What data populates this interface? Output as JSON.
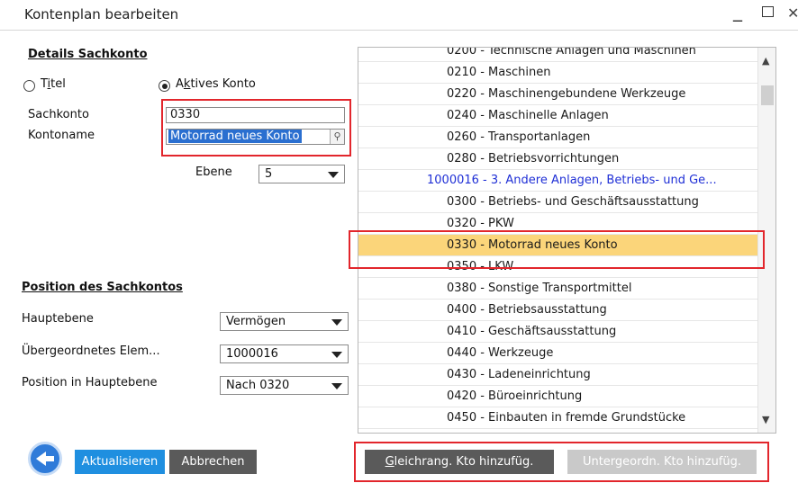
{
  "window": {
    "title": "Kontenplan bearbeiten",
    "min_icon": "minimize-icon",
    "max_icon": "maximize-icon",
    "close_icon": "close-icon"
  },
  "details": {
    "section_title": "Details Sachkonto",
    "radio_titel": {
      "label": "Titel",
      "underline_char": "i",
      "selected": false
    },
    "radio_aktiv": {
      "label": "Aktives Konto",
      "underline_char": "k",
      "selected": true
    },
    "sachkonto_label": "Sachkonto",
    "sachkonto_value": "0330",
    "kontoname_label": "Kontoname",
    "kontoname_value": "Motorrad neues Konto",
    "ebene_label": "Ebene",
    "ebene_value": "5"
  },
  "position": {
    "section_title": "Position des Sachkontos",
    "hauptebene_label": "Hauptebene",
    "hauptebene_value": "Vermögen",
    "uebergeordnet_label": "Übergeordnetes Elem...",
    "uebergeordnet_value": "1000016",
    "position_label": "Position in Hauptebene",
    "position_value": "Nach 0320"
  },
  "account_list": {
    "items": [
      {
        "text": "0200 - Technische Anlagen und Maschinen",
        "type": "child"
      },
      {
        "text": "0210 - Maschinen",
        "type": "child"
      },
      {
        "text": "0220 - Maschinengebundene Werkzeuge",
        "type": "child"
      },
      {
        "text": "0240 - Maschinelle Anlagen",
        "type": "child"
      },
      {
        "text": "0260 - Transportanlagen",
        "type": "child"
      },
      {
        "text": "0280 - Betriebsvorrichtungen",
        "type": "child"
      },
      {
        "text": "1000016 - 3. Andere Anlagen, Betriebs- und Ge...",
        "type": "parent"
      },
      {
        "text": "0300 - Betriebs- und Geschäftsausstattung",
        "type": "child"
      },
      {
        "text": "0320 - PKW",
        "type": "child"
      },
      {
        "text": "0330 - Motorrad neues Konto",
        "type": "selected"
      },
      {
        "text": "0350 - LKW",
        "type": "child"
      },
      {
        "text": "0380 - Sonstige Transportmittel",
        "type": "child"
      },
      {
        "text": "0400 - Betriebsausstattung",
        "type": "child"
      },
      {
        "text": "0410 - Geschäftsausstattung",
        "type": "child"
      },
      {
        "text": "0440 - Werkzeuge",
        "type": "child"
      },
      {
        "text": "0430 - Ladeneinrichtung",
        "type": "child"
      },
      {
        "text": "0420 - Büroeinrichtung",
        "type": "child"
      },
      {
        "text": "0450 - Einbauten in fremde Grundstücke",
        "type": "child"
      }
    ],
    "selected_color": "#fbd57a",
    "parent_color": "#1f2fd6"
  },
  "buttons": {
    "back_icon": "back-arrow-icon",
    "aktualisieren": "Aktualisieren",
    "abbrechen": "Abbrechen",
    "gleichrang": "Gleichrang. Kto hinzufüg.",
    "untergeordn": "Untergeordn. Kto hinzufüg."
  },
  "colors": {
    "accent_blue": "#1f8fe0",
    "highlight_red": "#e2262c",
    "selected_row": "#fbd57a"
  }
}
